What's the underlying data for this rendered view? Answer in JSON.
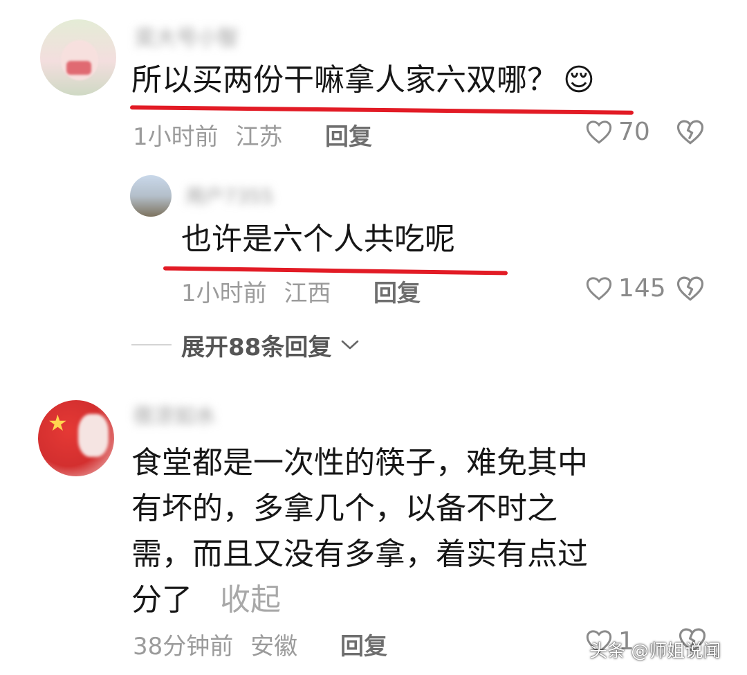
{
  "comments": [
    {
      "username": "奕大号小智",
      "content": "所以买两份干嘛拿人家六双哪？",
      "emoji": "😌",
      "time": "1小时前",
      "location": "江苏",
      "reply_label": "回复",
      "likes": "70"
    },
    {
      "username": "用户7355",
      "content": "也许是六个人共吃呢",
      "time": "1小时前",
      "location": "江西",
      "reply_label": "回复",
      "likes": "145"
    }
  ],
  "expand_label": "展开88条回复",
  "comment3": {
    "username": "夜凉如水",
    "lines": [
      "食堂都是一次性的筷子，难免其中",
      "有坏的，多拿几个，以备不时之",
      "需，而且又没有多拿，着实有点过",
      "分了"
    ],
    "collapse_label": "收起",
    "time": "38分钟前",
    "location": "安徽",
    "reply_label": "回复",
    "likes": "1"
  },
  "watermark": "头条 @师姐说闻"
}
